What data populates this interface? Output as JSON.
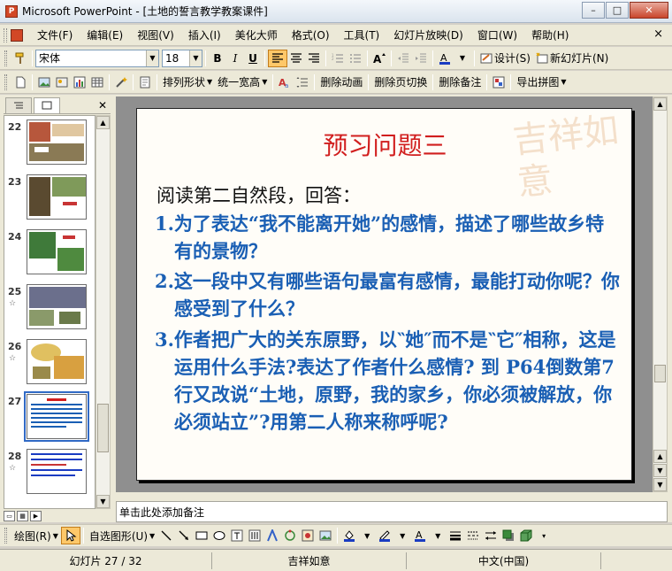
{
  "window": {
    "title": "Microsoft PowerPoint - [土地的誓言教学教案课件]",
    "minimize": "–",
    "maximize": "□",
    "close": "✕"
  },
  "menu": {
    "items": [
      "文件(F)",
      "编辑(E)",
      "视图(V)",
      "插入(I)",
      "美化大师",
      "格式(O)",
      "工具(T)",
      "幻灯片放映(D)",
      "窗口(W)",
      "帮助(H)"
    ],
    "close": "×"
  },
  "formatting": {
    "font_name": "宋体",
    "font_size": "18",
    "bold": "B",
    "italic": "I",
    "underline": "U",
    "design_label": "设计(S)",
    "new_slide_label": "新幻灯片(N)"
  },
  "toolbar2": {
    "arrange": "排列形状",
    "same_width": "统一宽高",
    "delete_animation": "删除动画",
    "delete_transition": "删除页切换",
    "delete_notes": "删除备注",
    "export_image": "导出拼图"
  },
  "slides": [
    {
      "num": "22",
      "star": ""
    },
    {
      "num": "23",
      "star": ""
    },
    {
      "num": "24",
      "star": ""
    },
    {
      "num": "25",
      "star": "☆"
    },
    {
      "num": "26",
      "star": "☆"
    },
    {
      "num": "27",
      "star": ""
    },
    {
      "num": "28",
      "star": "☆"
    }
  ],
  "slide": {
    "title": "预习问题三",
    "lead": "阅读第二自然段，回答：",
    "questions": [
      "1.为了表达“我不能离开她”的感情，描述了哪些故乡特有的景物？",
      "2.这一段中又有哪些语句最富有感情，最能打动你呢？你感受到了什么？",
      "3.作者把广大的关东原野，以‶她″而不是‶它″相称，这是运用什么手法?表达了作者什么感情? 到 P64倒数第7行又改说“土地，原野，我的家乡，你必须被解放，你必须站立”?用第二人称来称呼呢?"
    ],
    "deco": "吉祥如意"
  },
  "notes_placeholder": "单击此处添加备注",
  "drawbar": {
    "draw": "绘图(R)",
    "autoshapes": "自选图形(U)"
  },
  "status": {
    "slide_position": "幻灯片 27 / 32",
    "design": "吉祥如意",
    "language": "中文(中国)"
  },
  "colors": {
    "title_red": "#d11e1e",
    "question_blue": "#1a5fb4"
  }
}
